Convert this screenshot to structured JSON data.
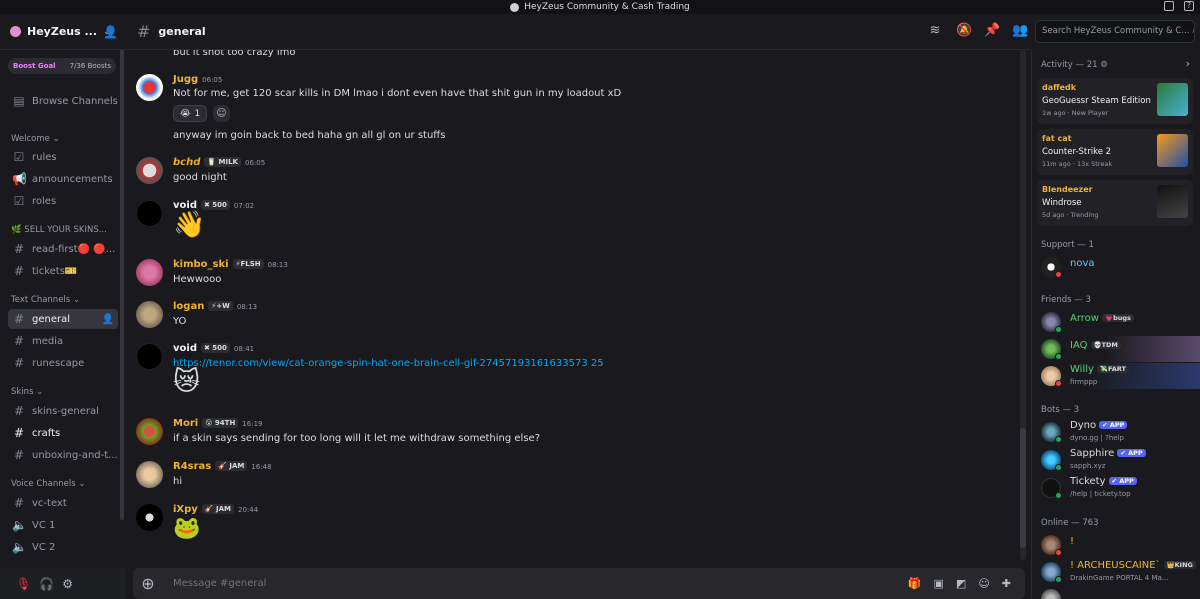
{
  "window": {
    "title": "HeyZeus Community & Cash Trading"
  },
  "server": {
    "name": "HeyZeus ...",
    "boost_label": "Boost Goal",
    "boost_count": "7/36 Boosts"
  },
  "sidebar": {
    "browse": "Browse Channels",
    "cat_welcome": "Welcome",
    "ch_rules": "rules",
    "ch_announcements": "announcements",
    "ch_roles": "roles",
    "cat_sell": "SELL YOUR SKINS...",
    "ch_readfirst": "read-first🔴 🔴...",
    "ch_tickets": "tickets🎫",
    "cat_text": "Text Channels",
    "ch_general": "general",
    "ch_media": "media",
    "ch_runescape": "runescape",
    "cat_skins": "Skins",
    "ch_skinsgeneral": "skins-general",
    "ch_crafts": "crafts",
    "ch_unboxing": "unboxing-and-t...",
    "cat_voice": "Voice Channels",
    "ch_vctext": "vc-text",
    "ch_vc1": "VC 1",
    "ch_vc2": "VC 2"
  },
  "header": {
    "channel": "general",
    "search_placeholder": "Search HeyZeus Community & C..."
  },
  "messages": {
    "m0": {
      "text": "but it snot too crazy imo"
    },
    "m1": {
      "user": "Jugg",
      "time": "06:05",
      "text": "Not for me, get 120 scar kills in DM lmao i dont even have that shit gun in my loadout xD",
      "reaction_count": "1",
      "text2": "anyway im goin back to bed haha gn all gl on ur stuffs"
    },
    "m2": {
      "user": "𝙗𝙘𝙝𝙙",
      "badge": "MILK",
      "time": "06:05",
      "text": "good night"
    },
    "m3": {
      "user": "void",
      "badge": "500",
      "time": "07:02",
      "emoji": "👋"
    },
    "m4": {
      "user": "kimbo_ski",
      "badge": "FLSH",
      "time": "08:13",
      "text": "Hewwooo"
    },
    "m5": {
      "user": "logan",
      "badge": "+W",
      "time": "08:13",
      "text": "YO"
    },
    "m6": {
      "user": "void",
      "badge": "500",
      "time": "08:41",
      "link": "https://tenor.com/view/cat-orange-spin-hat-one-brain-cell-gif-27457193161633573 25",
      "emoji": "😿"
    },
    "m7": {
      "user": "Mori",
      "badge": "94TH",
      "time": "16:19",
      "text": "if a skin says sending for too long will it let me withdraw something else?"
    },
    "m8": {
      "user": "R4sras",
      "badge": "JAM",
      "time": "16:48",
      "text": "hi"
    },
    "m9": {
      "user": "iXpy",
      "badge": "JAM",
      "time": "20:44",
      "emoji": "🐸"
    }
  },
  "composer": {
    "placeholder": "Message #general"
  },
  "right": {
    "activity_title": "Activity — 21",
    "a1": {
      "user": "daffedk",
      "game": "GeoGuessr Steam Edition",
      "meta": "1w ago  ·  New Player"
    },
    "a2": {
      "user": "fat cat",
      "game": "Counter-Strike 2",
      "meta": "11m ago  ·  13x Streak"
    },
    "a3": {
      "user": "Blendeezer",
      "game": "Windrose",
      "meta": "5d ago  ·  Trending"
    },
    "support_title": "Support — 1",
    "nova": "nova",
    "friends_title": "Friends — 3",
    "arrow": "Arrow",
    "arrow_tag": "bugs",
    "iaq": "IAQ",
    "iaq_tag": "TDM",
    "willy": "Willy",
    "willy_tag": "FART",
    "willy_sub": "firmppp",
    "bots_title": "Bots — 3",
    "dyno": "Dyno",
    "dyno_sub": "dyno.gg | ?help",
    "sapphire": "Sapphire",
    "sapphire_sub": "sapph.xyz",
    "tickety": "Tickety",
    "tickety_sub": "/help | tickety.top",
    "app_label": "APP",
    "online_title": "Online — 763",
    "o1": "!",
    "o2": "! ARCHEUSCAINE`",
    "o2_tag": "KING",
    "o2_sub": "DrakinGame PORTAL 4 Ma..."
  },
  "colors": {
    "accent": "#5865f2",
    "link": "#00a8fc",
    "online": "#23a55a",
    "dnd": "#f23f43",
    "idle": "#f0b232"
  }
}
